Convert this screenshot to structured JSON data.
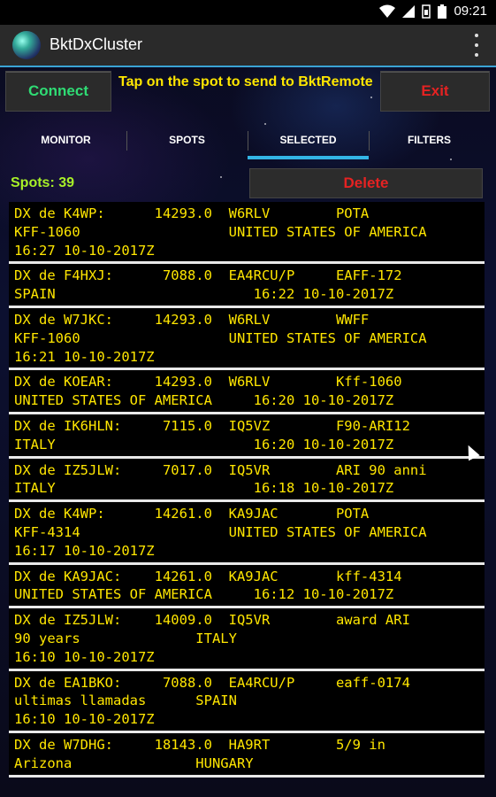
{
  "statusbar": {
    "time": "09:21",
    "icons": [
      "wifi-icon",
      "signal-icon",
      "battery-icon",
      "sim-icon"
    ]
  },
  "appbar": {
    "title": "BktDxCluster"
  },
  "toolbar": {
    "connect_label": "Connect",
    "hint": "Tap on the spot to send to BktRemote",
    "exit_label": "Exit"
  },
  "tabs": [
    {
      "label": "MONITOR",
      "active": false
    },
    {
      "label": "SPOTS",
      "active": false
    },
    {
      "label": "SELECTED",
      "active": true
    },
    {
      "label": "FILTERS",
      "active": false
    }
  ],
  "spots_label": "Spots: 39",
  "delete_label": "Delete",
  "colors": {
    "accent": "#33b5e5",
    "connect": "#2fdc74",
    "exit": "#e52222",
    "spot_text": "#ffe600",
    "count": "#a8f028"
  },
  "spots": [
    {
      "lines": [
        "DX de K4WP:      14293.0  W6RLV        POTA",
        "KFF-1060                  UNITED STATES OF AMERICA",
        "16:27 10-10-2017Z"
      ]
    },
    {
      "lines": [
        "DX de F4HXJ:      7088.0  EA4RCU/P     EAFF-172",
        "SPAIN                        16:22 10-10-2017Z"
      ]
    },
    {
      "lines": [
        "DX de W7JKC:     14293.0  W6RLV        WWFF",
        "KFF-1060                  UNITED STATES OF AMERICA",
        "16:21 10-10-2017Z"
      ]
    },
    {
      "lines": [
        "DX de KOEAR:     14293.0  W6RLV        Kff-1060",
        "UNITED STATES OF AMERICA     16:20 10-10-2017Z"
      ]
    },
    {
      "lines": [
        "DX de IK6HLN:     7115.0  IQ5VZ        F90-ARI12",
        "ITALY                        16:20 10-10-2017Z"
      ]
    },
    {
      "lines": [
        "DX de IZ5JLW:     7017.0  IQ5VR        ARI 90 anni",
        "ITALY                        16:18 10-10-2017Z"
      ]
    },
    {
      "lines": [
        "DX de K4WP:      14261.0  KA9JAC       POTA",
        "KFF-4314                  UNITED STATES OF AMERICA",
        "16:17 10-10-2017Z"
      ]
    },
    {
      "lines": [
        "DX de KA9JAC:    14261.0  KA9JAC       kff-4314",
        "UNITED STATES OF AMERICA     16:12 10-10-2017Z"
      ]
    },
    {
      "lines": [
        "DX de IZ5JLW:    14009.0  IQ5VR        award ARI",
        "90 years              ITALY",
        "16:10 10-10-2017Z"
      ]
    },
    {
      "lines": [
        "DX de EA1BKO:     7088.0  EA4RCU/P     eaff-0174",
        "ultimas llamadas      SPAIN",
        "16:10 10-10-2017Z"
      ]
    },
    {
      "lines": [
        "DX de W7DHG:     18143.0  HA9RT        5/9 in",
        "Arizona               HUNGARY"
      ]
    }
  ]
}
